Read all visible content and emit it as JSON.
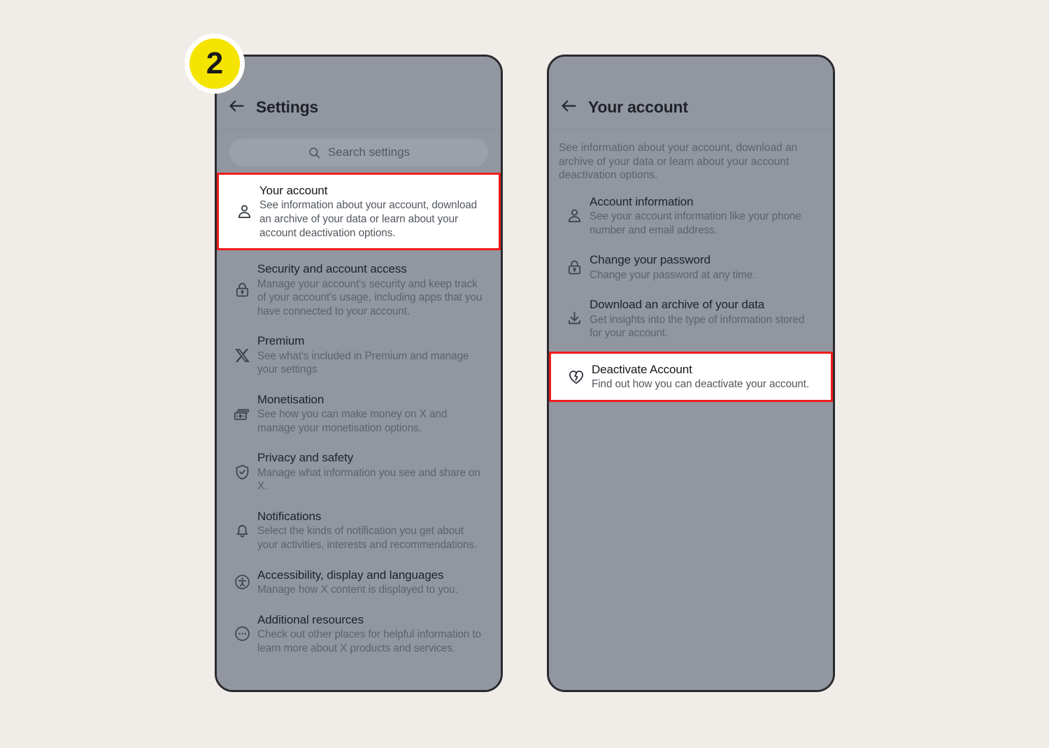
{
  "step_badge": {
    "number": "2"
  },
  "colors": {
    "page_background": "#f0ece8",
    "phone_background": "#9196a0",
    "badge_yellow": "#f5e400",
    "highlight_red": "#ef1c1c",
    "highlight_fill": "#ffffff",
    "title_text": "#1f2329",
    "subtitle_text": "#5d626a"
  },
  "left_phone": {
    "appbar": {
      "back_icon": "arrow-left-icon",
      "title": "Settings"
    },
    "search": {
      "icon": "search-icon",
      "placeholder": "Search settings"
    },
    "items": [
      {
        "icon": "person-icon",
        "title": "Your account",
        "subtitle": "See information about your account, download an archive of your data or learn about your account deactivation options.",
        "highlighted": true
      },
      {
        "icon": "lock-icon",
        "title": "Security and account access",
        "subtitle": "Manage your account's security and keep track of your account's usage, including apps that you have connected to your account.",
        "highlighted": false
      },
      {
        "icon": "x-logo-icon",
        "title": "Premium",
        "subtitle": "See what's included in Premium and manage your settings",
        "highlighted": false
      },
      {
        "icon": "money-icon",
        "title": "Monetisation",
        "subtitle": "See how you can make money on X and manage your monetisation options.",
        "highlighted": false
      },
      {
        "icon": "shield-check-icon",
        "title": "Privacy and safety",
        "subtitle": "Manage what information you see and share on X.",
        "highlighted": false
      },
      {
        "icon": "bell-icon",
        "title": "Notifications",
        "subtitle": "Select the kinds of notification you get about your activities, interests and recommendations.",
        "highlighted": false
      },
      {
        "icon": "accessibility-icon",
        "title": "Accessibility, display and languages",
        "subtitle": "Manage how X content is displayed to you.",
        "highlighted": false
      },
      {
        "icon": "ellipsis-circle-icon",
        "title": "Additional resources",
        "subtitle": "Check out other places for helpful information to learn more about X products and services.",
        "highlighted": false
      }
    ]
  },
  "right_phone": {
    "appbar": {
      "back_icon": "arrow-left-icon",
      "title": "Your account"
    },
    "description": "See information about your account, download an archive of your data or learn about your account deactivation options.",
    "items": [
      {
        "icon": "person-icon",
        "title": "Account information",
        "subtitle": "See your account information like your phone number and email address.",
        "highlighted": false
      },
      {
        "icon": "lock-icon",
        "title": "Change your password",
        "subtitle": "Change your password at any time.",
        "highlighted": false
      },
      {
        "icon": "download-icon",
        "title": "Download an archive of your data",
        "subtitle": "Get insights into the type of information stored for your account.",
        "highlighted": false
      },
      {
        "icon": "broken-heart-icon",
        "title": "Deactivate Account",
        "subtitle": "Find out how you can deactivate your account.",
        "highlighted": true
      }
    ]
  }
}
